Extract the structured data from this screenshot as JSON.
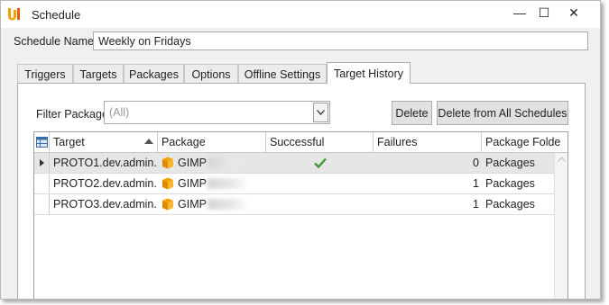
{
  "window": {
    "title": "Schedule",
    "minimize": "—",
    "maximize": "☐",
    "close": "✕"
  },
  "schedule_name": {
    "label": "Schedule Name",
    "value": "Weekly on Fridays"
  },
  "tabs": [
    {
      "label": "Triggers"
    },
    {
      "label": "Targets"
    },
    {
      "label": "Packages"
    },
    {
      "label": "Options"
    },
    {
      "label": "Offline Settings"
    },
    {
      "label": "Target History",
      "active": true
    }
  ],
  "filter": {
    "label": "Filter Package",
    "value": "(All)"
  },
  "buttons": {
    "delete": "Delete",
    "delete_all": "Delete from All Schedules"
  },
  "grid": {
    "columns": [
      "Target",
      "Package",
      "Successful",
      "Failures",
      "Package Folde"
    ],
    "rows": [
      {
        "target": "PROTO1.dev.admin...",
        "package": "GIMP",
        "successful": true,
        "failures": "0",
        "folder": "Packages",
        "selected": true
      },
      {
        "target": "PROTO2.dev.admin...",
        "package": "GIMP",
        "successful": false,
        "failures": "1",
        "folder": "Packages"
      },
      {
        "target": "PROTO3.dev.admin...",
        "package": "GIMP",
        "successful": false,
        "failures": "1",
        "folder": "Packages"
      }
    ]
  },
  "colors": {
    "accent_orange": "#f5a000",
    "check_green": "#3a9a3a"
  }
}
